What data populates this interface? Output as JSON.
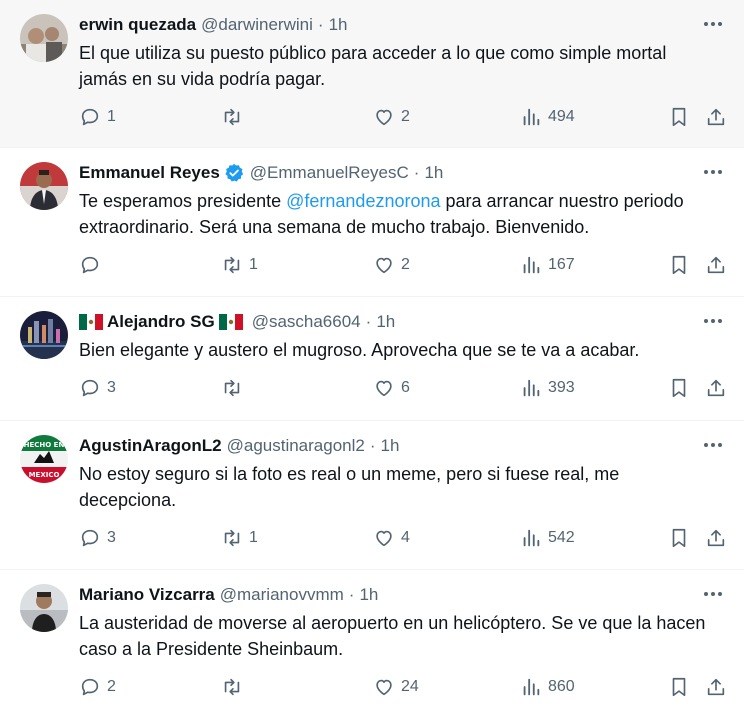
{
  "tweets": [
    {
      "name": "erwin quezada",
      "handle": "@darwinerwini",
      "time": "1h",
      "text_parts": [
        "El que utiliza su puesto público para acceder a lo que como simple mortal jamás en su vida podría pagar."
      ],
      "replies": "1",
      "retweets": "",
      "likes": "2",
      "views": "494",
      "highlighted": true
    },
    {
      "name": "Emmanuel Reyes",
      "handle": "@EmmanuelReyesC",
      "time": "1h",
      "verified": true,
      "text_before": "Te esperamos presidente ",
      "mention": "@fernandeznorona",
      "text_after": " para arrancar nuestro periodo extraordinario. Será una semana de mucho trabajo. Bienvenido.",
      "replies": "",
      "retweets": "1",
      "likes": "2",
      "views": "167"
    },
    {
      "name": "Alejandro SG",
      "handle": "@sascha6604",
      "time": "1h",
      "flags": true,
      "text_parts": [
        "Bien elegante y austero el mugroso. Aprovecha que se te va a acabar."
      ],
      "replies": "3",
      "retweets": "",
      "likes": "6",
      "views": "393"
    },
    {
      "name": "AgustinAragonL2",
      "handle": "@agustinaragonl2",
      "time": "1h",
      "avatar_text": [
        "HECHO EN",
        "MEXICO"
      ],
      "text_parts": [
        "No estoy seguro si la foto es real o un meme, pero si fuese real, me decepciona."
      ],
      "replies": "3",
      "retweets": "1",
      "likes": "4",
      "views": "542"
    },
    {
      "name": "Mariano Vizcarra",
      "handle": "@marianovvmm",
      "time": "1h",
      "text_parts": [
        "La austeridad de moverse al aeropuerto en un helicóptero. Se ve que la hacen caso a la Presidente Sheinbaum."
      ],
      "replies": "2",
      "retweets": "",
      "likes": "24",
      "views": "860"
    }
  ],
  "separator": "·",
  "colors": {
    "link": "#1d9bf0",
    "muted": "#536471",
    "verified": "#1d9bf0",
    "highlight_bg": "#f7f7f7"
  },
  "icons": [
    "reply-icon",
    "retweet-icon",
    "like-icon",
    "views-icon",
    "bookmark-icon",
    "share-icon",
    "more-icon",
    "verified-badge-icon",
    "mexico-flag-icon"
  ]
}
